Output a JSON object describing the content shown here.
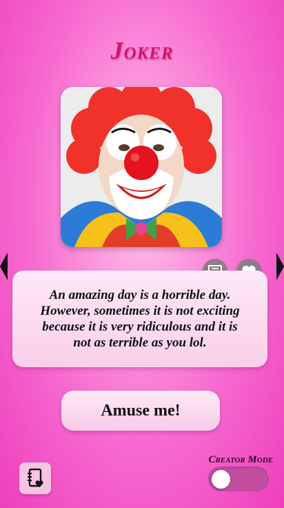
{
  "app": {
    "title": "Joker"
  },
  "quote": {
    "text": "An amazing day is a horrible day. However, sometimes it is not exciting because it is very ridiculous and it is not as terrible as you lol."
  },
  "actions": {
    "amuse_label": "Amuse me!"
  },
  "footer": {
    "creator_mode_label": "Creator Mode",
    "creator_mode_enabled": false
  },
  "colors": {
    "title": "#d4146a",
    "background": "#f76bd0",
    "card": "#fde8f6",
    "toggle_track": "#c34e9f",
    "icon_button": "#8e7c89"
  },
  "icons": {
    "nav_left": "triangle-left-icon",
    "nav_right": "triangle-right-icon",
    "comment": "chat-bubble-icon",
    "favorite": "heart-icon",
    "collection": "phone-book-heart-icon"
  }
}
